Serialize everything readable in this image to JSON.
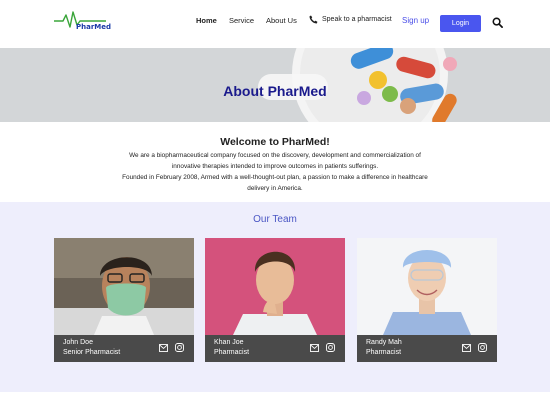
{
  "header": {
    "brand": "PharMed",
    "nav": {
      "home": "Home",
      "service": "Service",
      "about": "About Us"
    },
    "phone_label": "Speak to a pharmacist",
    "signup": "Sign up",
    "login": "Login",
    "icons": {
      "logo": "heartbeat-logo",
      "phone": "phone-icon",
      "search": "search-icon"
    },
    "accent_color": "#4a56ef"
  },
  "banner": {
    "title": "About PharMed"
  },
  "welcome": {
    "title": "Welcome to PharMed!",
    "line1": "We are a biopharmaceutical company focused on the discovery, development and commercialization of",
    "line2": "innovative therapies intended to improve outcomes in patients sufferings.",
    "line3": "Founded in February 2008, Armed with a well-thought-out plan, a passion to make a difference in healthcare",
    "line4": "delivery in America."
  },
  "team": {
    "title": "Our Team",
    "members": [
      {
        "name": "John Doe",
        "role": "Senior Pharmacist"
      },
      {
        "name": "Khan Joe",
        "role": "Pharmacist"
      },
      {
        "name": "Randy Mah",
        "role": "Pharmacist"
      }
    ],
    "icons": {
      "mail": "mail-icon",
      "social": "instagram-icon"
    }
  }
}
